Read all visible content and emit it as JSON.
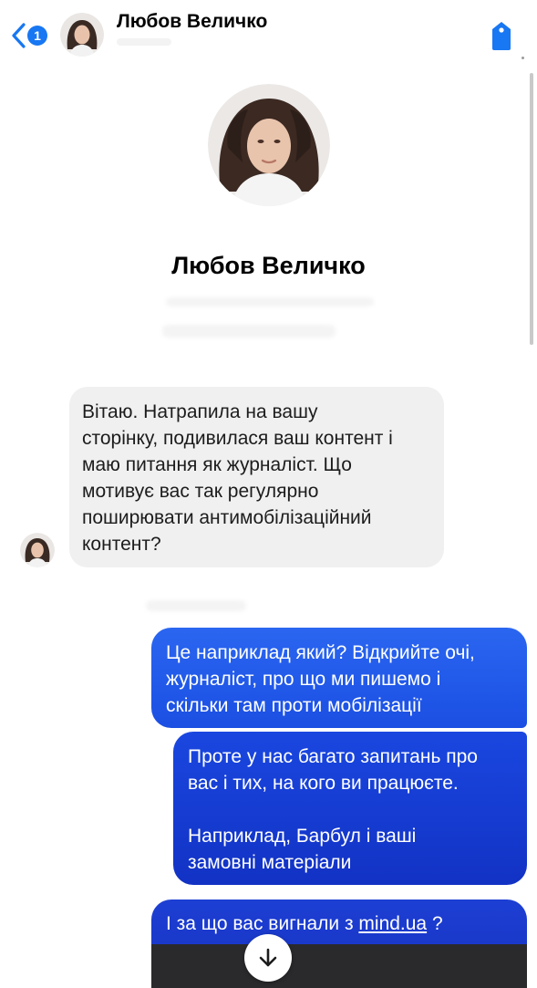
{
  "header": {
    "contact_name": "Любов Величко",
    "unread_count": "1",
    "back_icon": "chevron-left-icon",
    "action_icon": "tag-icon"
  },
  "profile": {
    "name": "Любов Величко"
  },
  "messages": [
    {
      "direction": "incoming",
      "text": "Вітаю. Натрапила на вашу\nсторінку, подивилася ваш контент і\nмаю питання як журналіст. Що\nмотивує вас так регулярно\nпоширювати антимобілізаційний\nконтент?"
    },
    {
      "direction": "outgoing",
      "text": "Це наприклад який? Відкрийте очі,\nжурналіст, про що ми пишемо і\nскільки там проти мобілізації"
    },
    {
      "direction": "outgoing",
      "text": "Проте у нас багато запитань про\nвас і тих, на кого ви працюєте.\n\nНаприклад, Барбул і ваші\nзамовні матеріали"
    },
    {
      "direction": "outgoing",
      "text_before": "І за що вас вигнали з ",
      "link": "mind.ua",
      "text_after": " ?"
    }
  ],
  "controls": {
    "scroll_down_icon": "arrow-down-icon"
  },
  "colors": {
    "accent": "#1877f2",
    "outgoing_bubble": "#1b4fe3",
    "incoming_bubble": "#f0f0f0"
  }
}
